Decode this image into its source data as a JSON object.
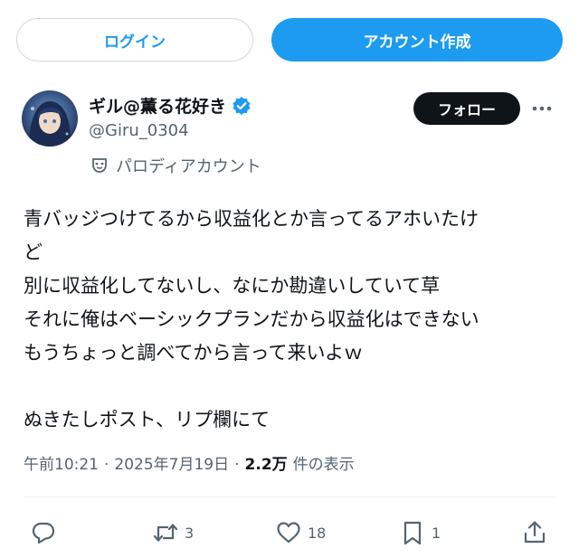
{
  "header": {
    "login_label": "ログイン",
    "signup_label": "アカウント作成"
  },
  "author": {
    "display_name": "ギル@薫る花好き",
    "handle": "@Giru_0304",
    "parody_label": "パロディアカウント",
    "verified": true,
    "follow_label": "フォロー"
  },
  "tweet": {
    "lines": [
      "青バッジつけてるから収益化とか言ってるアホいたけ",
      "ど",
      "別に収益化してないし、なにか勘違いしていて草",
      "それに俺はベーシックプランだから収益化はできない",
      "もうちょっと調べてから言って来いよｗ",
      "",
      "ぬきたしポスト、リプ欄にて"
    ]
  },
  "meta": {
    "time": "午前10:21",
    "separator": "·",
    "date": "2025年7月19日",
    "views": "2.2万",
    "views_label": "件の表示"
  },
  "actions": {
    "retweets": "3",
    "likes": "18",
    "bookmarks": "1"
  },
  "colors": {
    "accent": "#1d9bf0",
    "text": "#0f1419",
    "muted": "#536471"
  }
}
